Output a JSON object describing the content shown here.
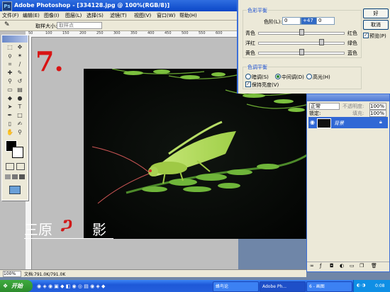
{
  "window": {
    "title": "Adobe Photoshop - [334128.jpg @ 100%(RGB/8)]"
  },
  "menu": [
    "文件(F)",
    "编辑(E)",
    "图像(I)",
    "图层(L)",
    "选择(S)",
    "滤镜(T)",
    "视图(V)",
    "窗口(W)",
    "帮助(H)"
  ],
  "options": {
    "sample_size_label": "取样大小:",
    "sample_size_value": "取样点"
  },
  "ruler_ticks": [
    "50",
    "100",
    "150",
    "200",
    "250",
    "300",
    "350",
    "400",
    "450",
    "500",
    "550",
    "600",
    "650"
  ],
  "step_label": "7.",
  "watermark": {
    "text_left": "三原",
    "text_right": "影"
  },
  "color_balance": {
    "group_title": "色彩平衡",
    "levels_label": "色阶(L):",
    "levels": [
      "0",
      "+47",
      "0"
    ],
    "sliders": [
      {
        "left": "青色",
        "right": "红色",
        "value": 0
      },
      {
        "left": "洋红",
        "right": "绿色",
        "value": 47
      },
      {
        "left": "黄色",
        "right": "蓝色",
        "value": 0
      }
    ],
    "tone_title": "色调平衡",
    "tone_options": [
      "暗调(S)",
      "中间调(D)",
      "高光(H)"
    ],
    "tone_selected": "中间调(D)",
    "preserve_label": "保持亮度(V)",
    "preserve_checked": true,
    "ok_label": "好",
    "cancel_label": "取消",
    "preview_label": "预览(P)",
    "preview_checked": true
  },
  "layers": {
    "blend_mode": "正常",
    "opacity_label": "不透明度:",
    "opacity": "100%",
    "lock_label": "锁定:",
    "fill_label": "填充:",
    "fill": "100%",
    "layer_name": "背景"
  },
  "status": {
    "zoom": "100%",
    "doc": "文档:791.0K/791.0K"
  },
  "taskbar": {
    "start": "开始",
    "tasks": [
      "蜂鸟论",
      "Adobe Ph...",
      "6 - 画图"
    ],
    "clock": "0:08"
  }
}
